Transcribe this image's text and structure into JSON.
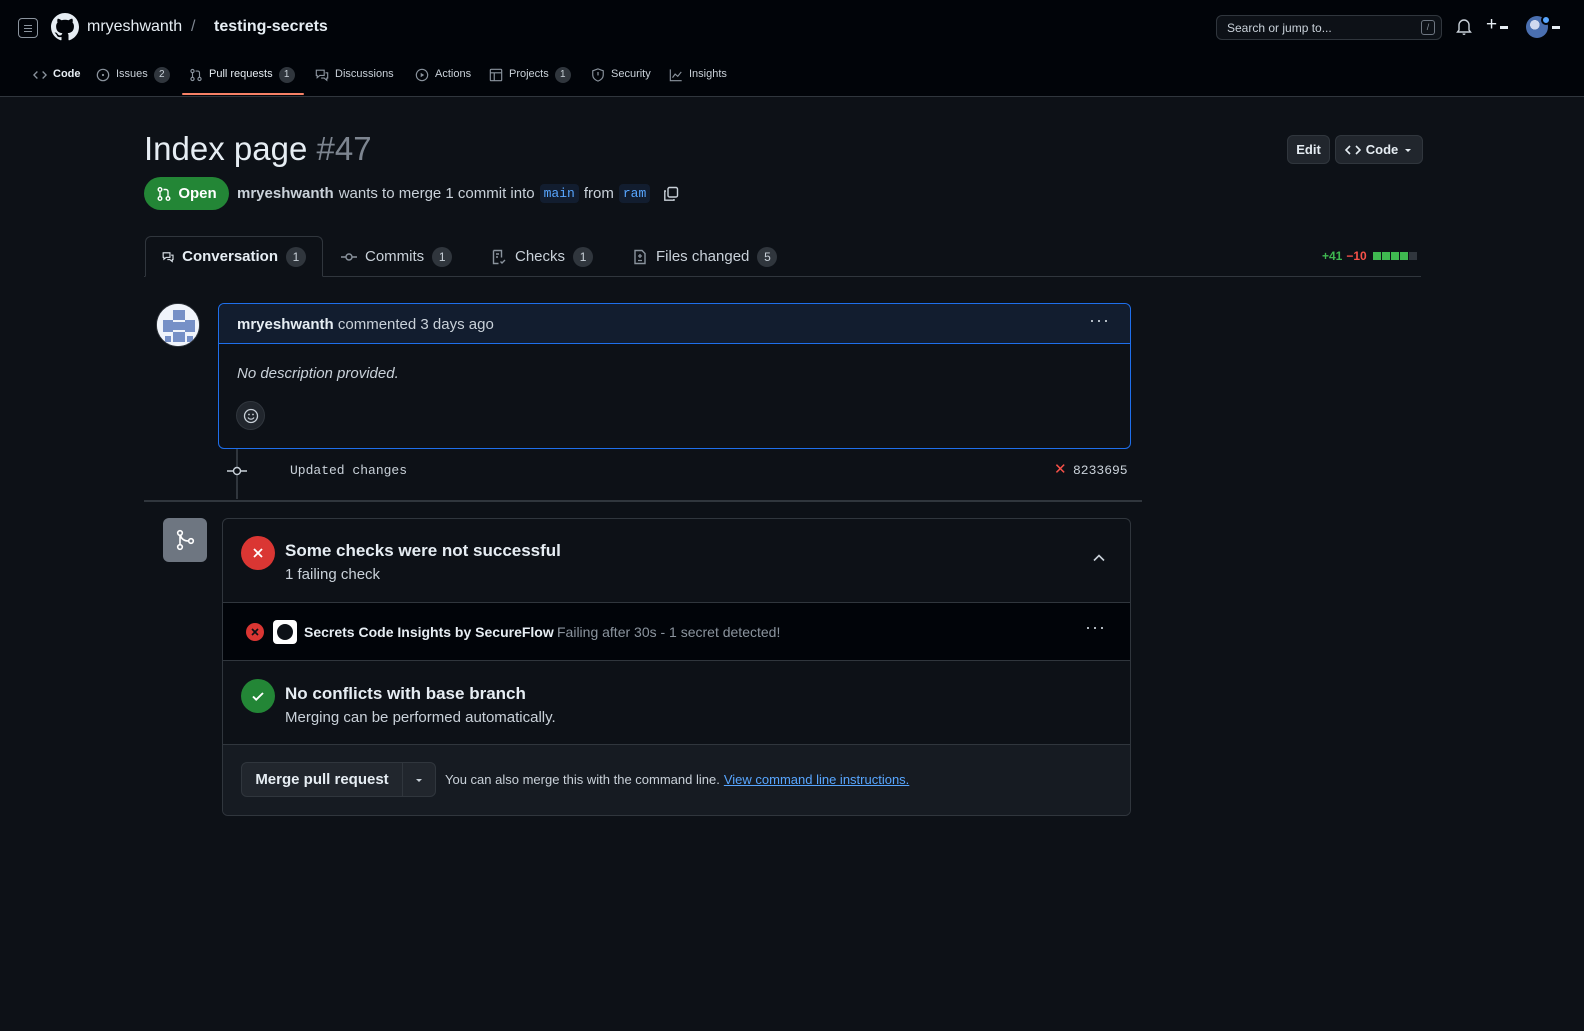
{
  "header": {
    "owner": "mryeshwanth",
    "separator": "/",
    "repo": "testing-secrets",
    "search_placeholder": "Search or jump to...",
    "search_shortcut": "/",
    "plus": "+"
  },
  "nav": [
    {
      "label": "Code",
      "icon": "code-icon",
      "count": null
    },
    {
      "label": "Issues",
      "icon": "issue-icon",
      "count": "2"
    },
    {
      "label": "Pull requests",
      "icon": "pull-request-icon",
      "count": "1",
      "active": true
    },
    {
      "label": "Discussions",
      "icon": "discussions-icon",
      "count": null
    },
    {
      "label": "Actions",
      "icon": "play-icon",
      "count": null
    },
    {
      "label": "Projects",
      "icon": "table-icon",
      "count": "1"
    },
    {
      "label": "Security",
      "icon": "shield-icon",
      "count": null
    },
    {
      "label": "Insights",
      "icon": "graph-icon",
      "count": null
    }
  ],
  "pr": {
    "title": "Index page",
    "number": "#47",
    "edit_label": "Edit",
    "code_label": "Code",
    "state": "Open",
    "author": "mryeshwanth",
    "merge_text": "wants to merge 1 commit into",
    "base_branch": "main",
    "from_text": "from",
    "head_branch": "ram"
  },
  "tabs": [
    {
      "label": "Conversation",
      "count": "1",
      "icon": "comment-icon"
    },
    {
      "label": "Commits",
      "count": "1",
      "icon": "commit-icon"
    },
    {
      "label": "Checks",
      "count": "1",
      "icon": "checklist-icon"
    },
    {
      "label": "Files changed",
      "count": "5",
      "icon": "file-diff-icon"
    }
  ],
  "diffstat": {
    "additions": "+41",
    "deletions": "−10",
    "colors": [
      "#3fb950",
      "#3fb950",
      "#3fb950",
      "#3fb950",
      "#30363d"
    ]
  },
  "comment": {
    "author": "mryeshwanth",
    "action": "commented 3 days ago",
    "body": "No description provided.",
    "menu": "···"
  },
  "commit": {
    "message": "Updated changes",
    "status": "✕",
    "sha": "8233695"
  },
  "checks": {
    "title": "Some checks were not successful",
    "subtitle": "1 failing check",
    "item_name": "Secrets Code Insights by SecureFlow",
    "item_desc": "Failing after 30s - 1 secret detected!",
    "item_menu": "···",
    "conflicts_title": "No conflicts with base branch",
    "conflicts_sub": "Merging can be performed automatically."
  },
  "merge": {
    "button": "Merge pull request",
    "note": "You can also merge this with the command line.",
    "link": "View command line instructions."
  },
  "colors": {
    "bg": "#0d1117",
    "open_green": "#238636",
    "fail_red": "#da3633",
    "success_green": "#238636",
    "link_blue": "#58a6ff"
  }
}
